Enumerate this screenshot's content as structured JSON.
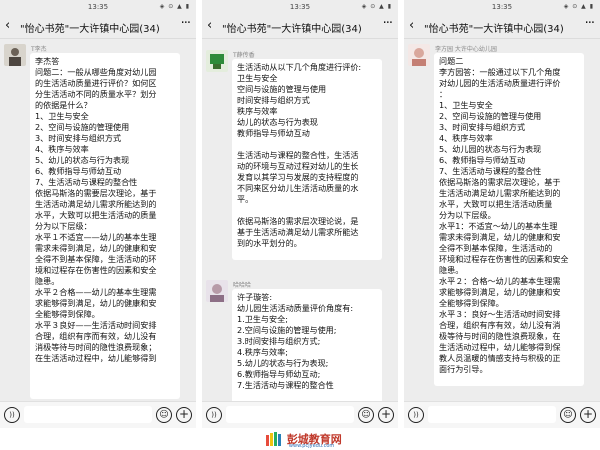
{
  "panels": [
    {
      "time": "13:35",
      "status_icons": "◈ ⊙ ▲ ▮",
      "title": "\"怡心书苑\"一大许镇中心园(34)",
      "message": {
        "sender": "T李杰",
        "lines": [
          "李杰答",
          "问题二：一般从哪些角度对幼儿园",
          "的生活活动质量进行评价？如何区",
          "分生活活动不同的质量水平？划分",
          "的依据是什么？",
          "1、卫生与安全",
          "2、空间与设施的管理使用",
          "3、时间安排与组织方式",
          "4、秩序与效率",
          "5、幼儿的状态与行为表现",
          "6、教师指导与师幼互动",
          "7、生活活动与课程的整合性",
          "依据马斯洛的需要层次理论，基于",
          "生活活动满足幼儿需求所能达到的",
          "水平，大致可以把生活活动的质量",
          "分为以下层级：",
          "水平１不适宜——幼儿的基本生理",
          "需求未得到满足，幼儿的健康和安",
          "全得不到基本保障，生活活动的环",
          "境和过程存在伤害性的因素和安全",
          "隐患。",
          "水平２合格——幼儿的基本生理需",
          "求能够得到满足，幼儿的健康和安",
          "全能够得到保障。",
          "水平３良好——生活活动时间安排",
          "合理，组织有序而有效，幼儿没有",
          "消极等待与时间的隐性浪费现象；",
          "在生活活动过程中，幼儿能够得到"
        ]
      }
    },
    {
      "time": "13:35",
      "status_icons": "◈ ⊙ ▲ ▮",
      "title": "\"怡心书苑\"一大许镇中心园(34)",
      "message": {
        "sender": "T薛传香",
        "lines": [
          "生活活动从以下几个角度进行评价:",
          "卫生与安全",
          "空间与设施的管理与使用",
          "时间安排与组织方式",
          "秩序与效率",
          "幼儿的状态与行为表现",
          "教师指导与师幼互动",
          "",
          "生活活动与课程的整合性，生活活",
          "动的环境与互动过程对幼儿的生长",
          "发育以其学习与发展的支持程度的",
          "不同来区分幼儿生活活动质量的水",
          "平。",
          "",
          "依据马斯洛的需求层次理论说，是",
          "基于生活活动满足幼儿需求所能达",
          "到的水平划分的。"
        ]
      },
      "message2": {
        "sender": "哈哈哈",
        "lines": [
          "许子璇答:",
          "幼儿园生活活动质量评价角度有:",
          "1.卫生与安全;",
          "2.空间与设施的管理与使用;",
          "3.时间安排与组织方式;",
          "4.秩序与效率;",
          "5.幼儿的状态与行为表现;",
          "6.教师指导与师幼互动;",
          "7.生活活动与课程的整合性"
        ]
      }
    },
    {
      "time": "13:35",
      "status_icons": "◈ ⊙ ▲ ▮",
      "title": "\"怡心书苑\"一大许镇中心园(34)",
      "message": {
        "sender": "李方园 大许中心幼儿园",
        "lines": [
          "问题二",
          "李方园答：一般通过以下几个角度",
          "对幼儿园的生活活动质量进行评价",
          "：",
          "1、卫生与安全",
          "2、空间与设施的管理与使用",
          "3、时间安排与组织方式",
          "4、秩序与效率",
          "5、幼儿园的状态与行为表现",
          "6、教师指导与师幼互动",
          "7、生活活动与课程的整合性",
          "依据马斯洛的需求层次理论，基于",
          "生活活动满足幼儿需求所能达到的",
          "水平，大致可以把生活活动质量",
          "分为以下层级。",
          "水平1：不适宜～幼儿的基本生理",
          "需求未得到满足，幼儿的健康和安",
          "全得不到基本保障，生活活动的",
          "环境和过程存在伤害性的因素和安全",
          "隐患。",
          "水平２：合格～幼儿的基本生理需",
          "求能够得到满足，幼儿的健康和安",
          "全能够得到保障。",
          "水平３：良好～生活活动时间安排",
          "合理，组织有序有效，幼儿没有消",
          "极等待与时间的隐性浪费现象，在",
          "生活活动过程中，幼儿能够得到保",
          "教人员温暖的情感支持与积极的正",
          "面行为引导。"
        ]
      }
    }
  ],
  "watermark": {
    "text": "彭城教育网",
    "url": "www.pcjyedu.com"
  },
  "colors": {
    "panel_bg": "#ededed",
    "bubble_bg": "#ffffff",
    "watermark_red": "#c0392b",
    "watermark_blue": "#2a6db5"
  },
  "icons": {
    "back": "back-arrow-icon",
    "more": "more-dots-icon",
    "voice": "voice-icon",
    "emoji": "emoji-icon",
    "plus": "plus-icon"
  }
}
